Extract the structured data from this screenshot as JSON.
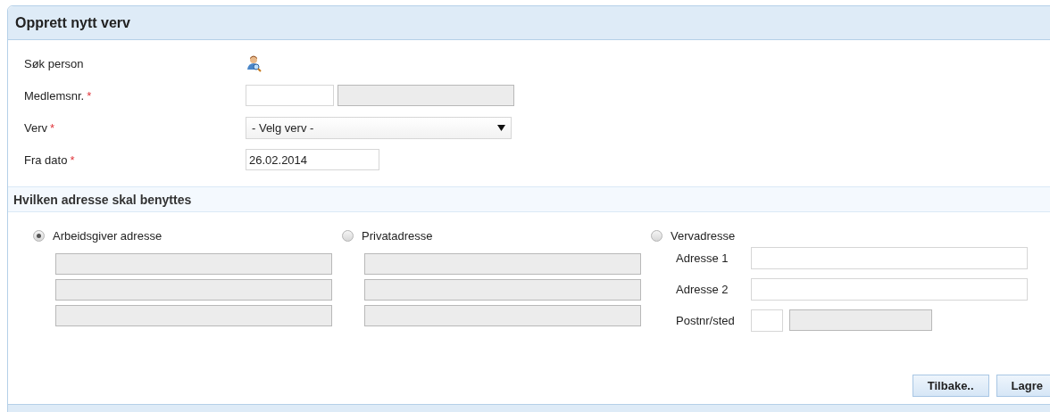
{
  "panel": {
    "title": "Opprett nytt verv"
  },
  "form": [
    {
      "kind": "search",
      "label": "Søk person"
    },
    {
      "kind": "member",
      "label": "Medlemsnr.",
      "mark": "*",
      "fields": [
        {
          "disabled": false
        },
        {
          "disabled": true
        }
      ]
    },
    {
      "kind": "select",
      "label": "Verv",
      "mark": "*",
      "value": "- Velg verv -"
    },
    {
      "kind": "date",
      "label": "Fra dato",
      "mark": "*",
      "value": "26.02.2014"
    }
  ],
  "address_section": {
    "title": "Hvilken adresse skal benyttes",
    "options": [
      {
        "label": "Arbeidsgiver adresse",
        "selected": true,
        "kind": "lines",
        "fields": [
          {
            "disabled": true
          },
          {
            "disabled": true
          },
          {
            "disabled": true
          }
        ]
      },
      {
        "label": "Privatadresse",
        "selected": false,
        "kind": "lines",
        "fields": [
          {
            "disabled": true
          },
          {
            "disabled": true
          },
          {
            "disabled": true
          }
        ]
      },
      {
        "label": "Vervadresse",
        "selected": false,
        "kind": "labeled",
        "rows": [
          {
            "label": "Adresse 1",
            "kind": "single"
          },
          {
            "label": "Adresse 2",
            "kind": "single"
          },
          {
            "label": "Postnr/sted",
            "kind": "postal"
          }
        ]
      }
    ]
  },
  "buttons": [
    {
      "label": "Tilbake.."
    },
    {
      "label": "Lagre"
    }
  ]
}
